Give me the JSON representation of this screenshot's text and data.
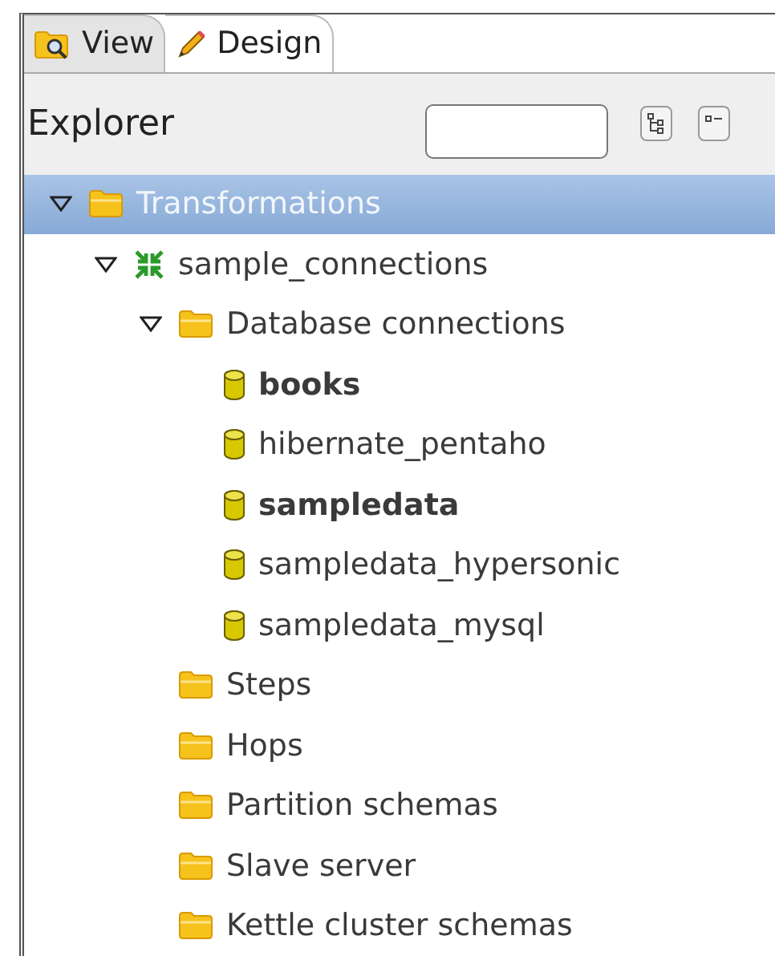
{
  "tabs": [
    {
      "label": "View",
      "kind": "view",
      "selected": true
    },
    {
      "label": "Design",
      "kind": "design",
      "selected": false
    }
  ],
  "explorer": {
    "title": "Explorer"
  },
  "tree": [
    {
      "label": "Transformations",
      "kind": "folder",
      "selected": true,
      "expanded": true,
      "children": [
        {
          "label": "sample_connections",
          "kind": "transformation",
          "selected": false,
          "expanded": true,
          "children": [
            {
              "label": "Database connections",
              "kind": "folder",
              "selected": false,
              "expanded": true,
              "children": [
                {
                  "label": "books",
                  "kind": "connection",
                  "selected": false,
                  "bold": true
                },
                {
                  "label": "hibernate_pentaho",
                  "kind": "connection",
                  "selected": false,
                  "bold": false
                },
                {
                  "label": "sampledata",
                  "kind": "connection",
                  "selected": false,
                  "bold": true
                },
                {
                  "label": "sampledata_hypersonic",
                  "kind": "connection",
                  "selected": false,
                  "bold": false
                },
                {
                  "label": "sampledata_mysql",
                  "kind": "connection",
                  "selected": false,
                  "bold": false
                }
              ]
            },
            {
              "label": "Steps",
              "kind": "folder",
              "selected": false
            },
            {
              "label": "Hops",
              "kind": "folder",
              "selected": false
            },
            {
              "label": "Partition schemas",
              "kind": "folder",
              "selected": false
            },
            {
              "label": "Slave server",
              "kind": "folder",
              "selected": false
            },
            {
              "label": "Kettle cluster schemas",
              "kind": "folder",
              "selected": false
            }
          ]
        }
      ]
    }
  ]
}
